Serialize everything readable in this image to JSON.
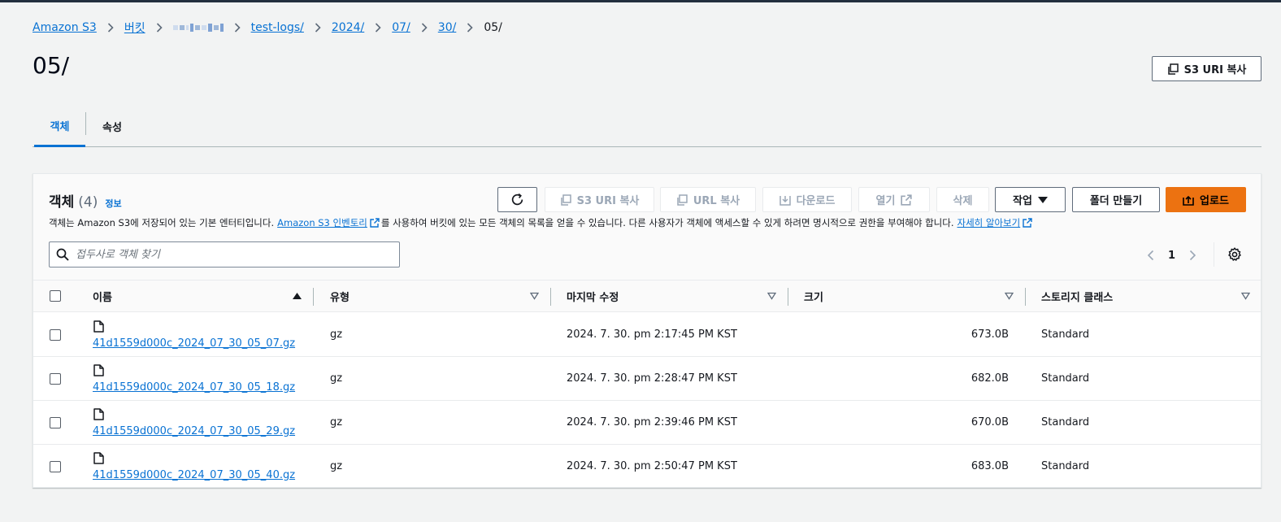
{
  "breadcrumb": {
    "items": [
      "Amazon S3",
      "버킷",
      "",
      "test-logs/",
      "2024/",
      "07/",
      "30/"
    ],
    "current": "05/"
  },
  "page": {
    "title": "05/",
    "copy_uri_label": "S3 URI 복사"
  },
  "tabs": [
    {
      "label": "객체",
      "active": true
    },
    {
      "label": "속성",
      "active": false
    }
  ],
  "panel": {
    "title": "객체",
    "count": "(4)",
    "info_label": "정보",
    "desc_part1": "객체는 Amazon S3에 저장되어 있는 기본 엔터티입니다.",
    "desc_link1": "Amazon S3 인벤토리",
    "desc_part2": "를 사용하여 버킷에 있는 모든 객체의 목록을 얻을 수 있습니다. 다른 사용자가 객체에 액세스할 수 있게 하려면 명시적으로 권한을 부여해야 합니다.",
    "desc_link2": "자세히 알아보기"
  },
  "toolbar": {
    "copy_s3_uri": "S3 URI 복사",
    "copy_url": "URL 복사",
    "download": "다운로드",
    "open": "열기",
    "delete": "삭제",
    "actions": "작업",
    "create_folder": "폴더 만들기",
    "upload": "업로드"
  },
  "search": {
    "placeholder": "접두사로 객체 찾기"
  },
  "pagination": {
    "current_page": "1"
  },
  "table": {
    "headers": [
      "이름",
      "유형",
      "마지막 수정",
      "크기",
      "스토리지 클래스"
    ],
    "sorted_column": "이름",
    "sort_direction": "ascending",
    "rows": [
      {
        "name": "41d1559d000c_2024_07_30_05_07.gz",
        "type": "gz",
        "modified": "2024. 7. 30. pm 2:17:45 PM KST",
        "size": "673.0B",
        "storage": "Standard"
      },
      {
        "name": "41d1559d000c_2024_07_30_05_18.gz",
        "type": "gz",
        "modified": "2024. 7. 30. pm 2:28:47 PM KST",
        "size": "682.0B",
        "storage": "Standard"
      },
      {
        "name": "41d1559d000c_2024_07_30_05_29.gz",
        "type": "gz",
        "modified": "2024. 7. 30. pm 2:39:46 PM KST",
        "size": "670.0B",
        "storage": "Standard"
      },
      {
        "name": "41d1559d000c_2024_07_30_05_40.gz",
        "type": "gz",
        "modified": "2024. 7. 30. pm 2:50:47 PM KST",
        "size": "683.0B",
        "storage": "Standard"
      }
    ]
  },
  "colors": {
    "link": "#0972d3",
    "primary_button": "#ec7211",
    "background": "#f2f3f3"
  }
}
